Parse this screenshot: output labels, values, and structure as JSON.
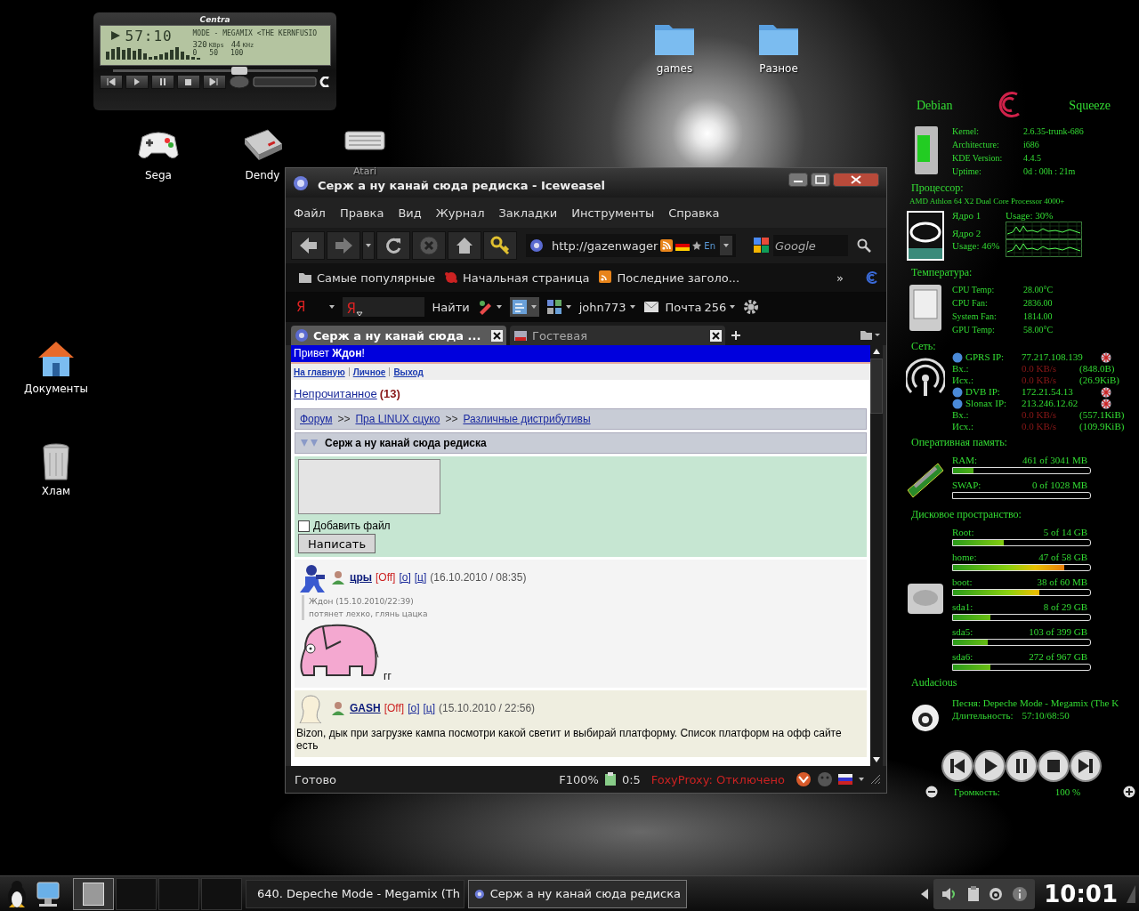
{
  "player": {
    "title": "Centra",
    "time": "57:10",
    "track": "MODE - MEGAMIX <THE KERNFUSIO",
    "bitrate": "320",
    "bitrate_unit": "KBps",
    "freq": "44",
    "freq_unit": "KHz",
    "scale": [
      "0",
      "50",
      "100"
    ],
    "level": 0.62
  },
  "desktop_icons": [
    {
      "label": "games",
      "kind": "folder"
    },
    {
      "label": "Разное",
      "kind": "folder"
    },
    {
      "label": "Sega",
      "kind": "gamepad"
    },
    {
      "label": "Dendy",
      "kind": "console"
    },
    {
      "label": "Atari",
      "kind": "keyboard"
    },
    {
      "label": "Документы",
      "kind": "home"
    },
    {
      "label": "Хлам",
      "kind": "trash"
    }
  ],
  "browser": {
    "title": "Серж а ну канай сюда редиска - Iceweasel",
    "menu": [
      "Файл",
      "Правка",
      "Вид",
      "Журнал",
      "Закладки",
      "Инструменты",
      "Справка"
    ],
    "url": "http://gazenwager",
    "lang": "En",
    "search_placeholder": "Google",
    "bookmarks": [
      {
        "label": "Самые популярные",
        "kind": "folder"
      },
      {
        "label": "Начальная страница",
        "kind": "page"
      },
      {
        "label": "Последние заголо...",
        "kind": "feed"
      }
    ],
    "bookmarks_more": "»",
    "yandex": {
      "logo": "Я",
      "field_logo": "Я",
      "find": "Найти",
      "user": "john773",
      "mail": "Почта",
      "mail_count": "256"
    },
    "tabs": [
      {
        "label": "Серж а ну канай сюда ...",
        "selected": true
      },
      {
        "label": "Гостевая",
        "selected": false
      }
    ],
    "page": {
      "greeting": "Привет **Ждон**!",
      "nav": [
        "На главную",
        "Личное",
        "Выход"
      ],
      "unread": "Непрочитанное",
      "unread_count": "(13)",
      "breadcrumb": [
        "Форум",
        "Пра LINUX сцуко",
        "Различные дистрибутивы"
      ],
      "breadcrumb_sep": ">>",
      "topic": "Серж а ну канай сюда редиска",
      "attach_label": "Добавить файл",
      "attach_checked": false,
      "submit": "Написать",
      "posts": [
        {
          "author": "цры",
          "status": "[Off]",
          "links": [
            "[о]",
            "[ц]"
          ],
          "date": "(16.10.2010 / 08:35)",
          "kind": "robot",
          "quote_head": "Ждон (15.10.2010/22:39)",
          "quote_text": "потянет лехко, глянь цацка",
          "image": true,
          "text": "гг"
        },
        {
          "author": "GASH",
          "status": "[Off]",
          "links": [
            "[о]",
            "[ц]"
          ],
          "date": "(15.10.2010 / 22:56)",
          "kind": "head",
          "text": "Bizon, дык при загрузке кампа посмотри какой светит и выбирай платформу. Список платформ на офф сайте есть"
        }
      ]
    },
    "status": {
      "text": "Готово",
      "zoom": "F100%",
      "counter": "0:5",
      "proxy": "FoxyProxy: Отключено"
    }
  },
  "conky": {
    "distro": "Debian",
    "release": "Squeeze",
    "system": [
      {
        "label": "Kernel:",
        "value": "2.6.35-trunk-686"
      },
      {
        "label": "Architecture:",
        "value": "i686"
      },
      {
        "label": "KDE Version:",
        "value": "4.4.5"
      },
      {
        "label": "Uptime:",
        "value": "0d : 00h : 21m"
      }
    ],
    "cpu_heading": "Процессор:",
    "cpu_model": "AMD Athlon 64 X2 Dual Core Processor 4000+",
    "cores": [
      {
        "name": "Ядро 1",
        "usage": "Usage: 30%"
      },
      {
        "name": "Ядро 2",
        "usage": "Usage: 46%"
      }
    ],
    "temp_heading": "Температура:",
    "temps": [
      {
        "label": "CPU Temp:",
        "value": "28.00°C"
      },
      {
        "label": "CPU Fan:",
        "value": "2836.00"
      },
      {
        "label": "System Fan:",
        "value": "1814.00"
      },
      {
        "label": "GPU Temp:",
        "value": "58.00°C"
      }
    ],
    "net_heading": "Сеть:",
    "net": [
      {
        "kind": "ip",
        "label": "GPRS IP:",
        "value": "77.217.108.139"
      },
      {
        "kind": "traffic",
        "label": "Вх.:",
        "rate": "0.0 KB/s",
        "total": "(848.0B)"
      },
      {
        "kind": "traffic",
        "label": "Исх.:",
        "rate": "0.0 KB/s",
        "total": "(26.9KiB)"
      },
      {
        "kind": "ip",
        "label": "DVB IP:",
        "value": "172.21.54.13"
      },
      {
        "kind": "ip",
        "label": "Slonax IP:",
        "value": "213.246.12.62"
      },
      {
        "kind": "traffic",
        "label": "Вх.:",
        "rate": "0.0 KB/s",
        "total": "(557.1KiB)"
      },
      {
        "kind": "traffic",
        "label": "Исх.:",
        "rate": "0.0 KB/s",
        "total": "(109.9KiB)"
      }
    ],
    "mem_heading": "Оперативная память:",
    "memory": [
      {
        "label": "RAM:",
        "value": "461 of 3041 MB",
        "level": 0.15
      },
      {
        "label": "SWAP:",
        "value": "0 of 1028 MB",
        "level": 0
      }
    ],
    "disk_heading": "Дисковое пространство:",
    "disks": [
      {
        "label": "Root:",
        "value": "5 of 14 GB",
        "level": 0.37
      },
      {
        "label": "home:",
        "value": "47 of 58 GB",
        "level": 0.81
      },
      {
        "label": "boot:",
        "value": "38 of 60 MB",
        "level": 0.63
      },
      {
        "label": "sda1:",
        "value": "8 of 29 GB",
        "level": 0.27
      },
      {
        "label": "sda5:",
        "value": "103 of 399 GB",
        "level": 0.25
      },
      {
        "label": "sda6:",
        "value": "272 of 967 GB",
        "level": 0.27
      }
    ],
    "audio_heading": "Audacious",
    "song": "Песня: Depeche Mode - Megamix (The K",
    "duration_label": "Длительность:",
    "duration": "57:10/68:50",
    "volume_label": "Громкость:",
    "volume": "100 %"
  },
  "taskbar": {
    "pager": [
      {
        "selected": true
      },
      {
        "selected": false
      },
      {
        "selected": false
      },
      {
        "selected": false
      }
    ],
    "tasks": [
      {
        "label": "640. Depeche Mode - Megamix (Th",
        "kind": "player",
        "selected": false
      },
      {
        "label": "Серж а ну канай сюда редиска",
        "kind": "browser",
        "selected": true
      }
    ],
    "clock": "10:01"
  }
}
